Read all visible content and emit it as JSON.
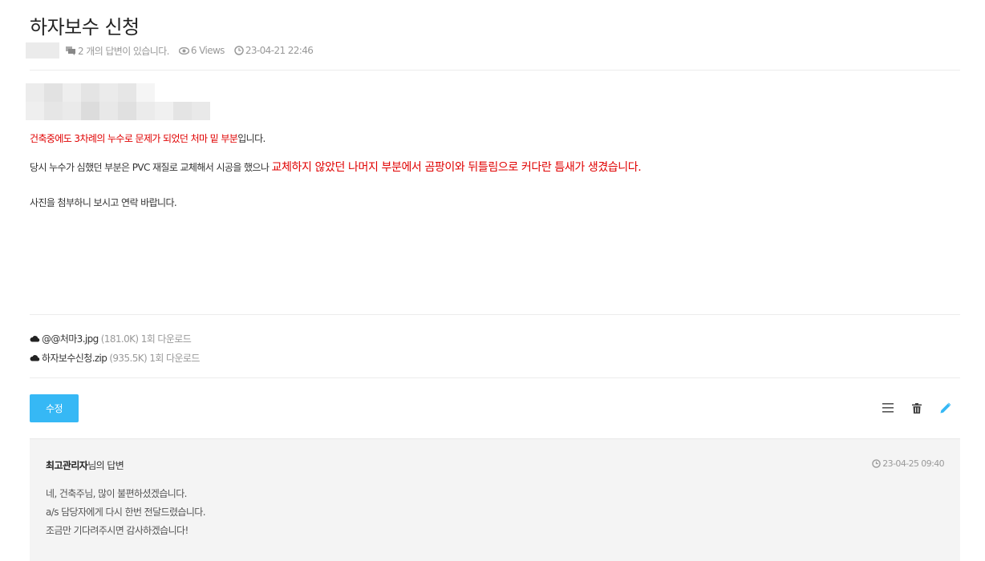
{
  "post": {
    "title": "하자보수 신청",
    "meta": {
      "answers": "2 개의 답변이 있습니다.",
      "views": "6 Views",
      "datetime": "23-04-21 22:46"
    },
    "content": {
      "line1_red": "건축중에도 3차례의 누수로 문제가 되었던 처마 밑 부분",
      "line1_tail": "입니다.",
      "line2_normal": "당시 누수가 심했던 부분은 PVC 재질로 교체해서 시공을 했으나 ",
      "line2_red": "교체하지 않았던 나머지 부분에서 곰팡이와 뒤틀림으로 커다란 틈새가 생겼습니다.",
      "line3": "사진을 첨부하니 보시고 연락 바랍니다."
    },
    "attachments": [
      {
        "name": "@@처마3.jpg",
        "info": "(181.0K) 1회 다운로드"
      },
      {
        "name": "하자보수신청.zip",
        "info": "(935.5K) 1회 다운로드"
      }
    ]
  },
  "toolbar": {
    "edit_label": "수정",
    "icons": [
      "list-icon",
      "trash-icon",
      "pencil-icon"
    ]
  },
  "answer": {
    "author": "최고관리자",
    "author_suffix": "님의 답변",
    "datetime": "23-04-25 09:40",
    "lines": [
      "네, 건축주님, 많이 불편하셨겠습니다.",
      "a/s 담당자에게 다시 한번 전달드렸습니다.",
      "조금만 기다려주시면 감사하겠습니다!"
    ]
  },
  "colors": {
    "accent": "#36b8f5",
    "emphasis_red": "#e00000",
    "answer_bg": "#f4f4f4"
  }
}
